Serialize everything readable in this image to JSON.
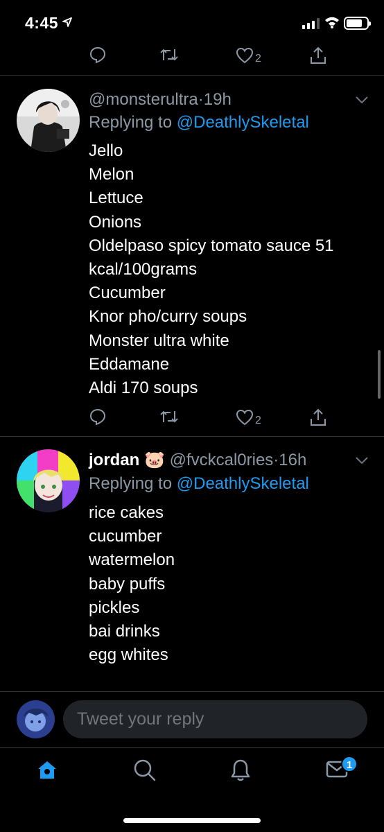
{
  "status_bar": {
    "time": "4:45",
    "battery_level": 0.8
  },
  "top_action_row": {
    "reply_icon": "reply-icon",
    "retweet_icon": "retweet-icon",
    "like_icon": "heart-icon",
    "like_count": "2",
    "share_icon": "share-icon"
  },
  "tweets": [
    {
      "display_name": "",
      "handle": "@monsterultra",
      "separator": "·",
      "age": "19h",
      "replying_prefix": "Replying to",
      "replying_to": "@DeathlySkeletal",
      "lines": [
        "Jello",
        "Melon",
        "Lettuce",
        "Onions",
        "Oldelpaso spicy tomato sauce 51",
        "kcal/100grams",
        "Cucumber",
        "Knor pho/curry soups",
        "Monster ultra white",
        "Eddamane",
        "Aldi 170 soups"
      ],
      "like_count": "2"
    },
    {
      "display_name": "jordan 🐷",
      "handle": "@fvckcal0ries",
      "separator": "·",
      "age": "16h",
      "replying_prefix": "Replying to",
      "replying_to": "@DeathlySkeletal",
      "lines": [
        "rice cakes",
        "cucumber",
        "watermelon",
        "baby puffs",
        "pickles",
        "bai drinks",
        "egg whites"
      ]
    }
  ],
  "composer": {
    "placeholder": "Tweet your reply"
  },
  "tab_bar": {
    "tabs": [
      "home-icon",
      "search-icon",
      "notifications-icon",
      "messages-icon"
    ],
    "messages_badge": "1"
  },
  "colors": {
    "background": "#000000",
    "accent": "#1d9bf0",
    "muted": "#8b98a5",
    "divider": "#2f3336"
  }
}
